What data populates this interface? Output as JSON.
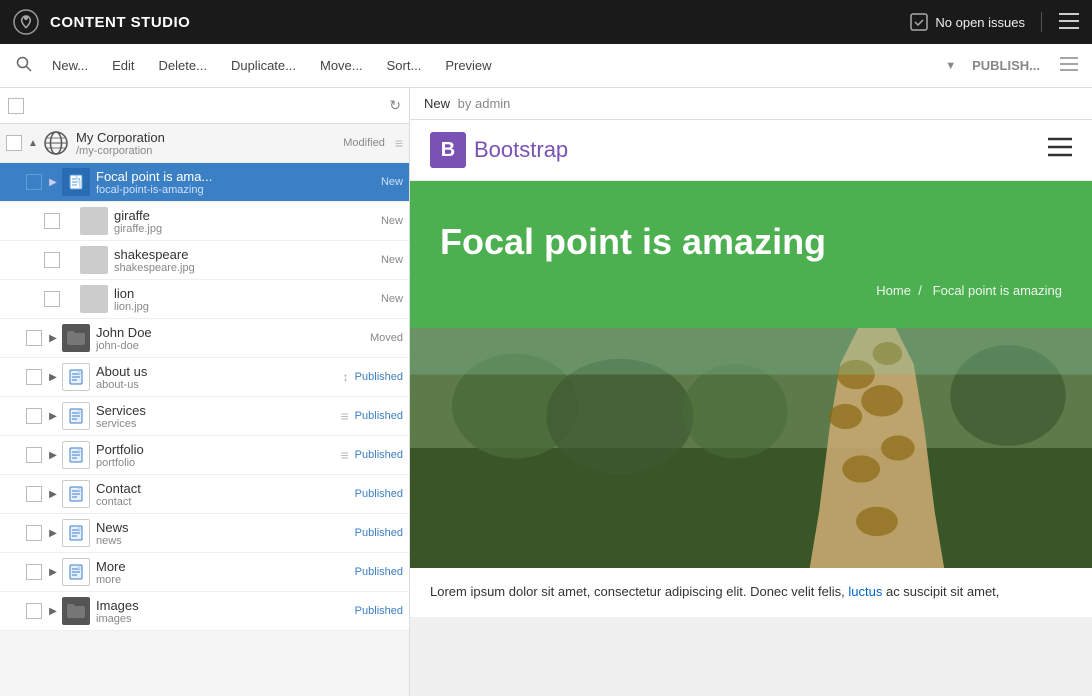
{
  "app": {
    "title": "CONTENT STUDIO",
    "issues": "No open issues"
  },
  "toolbar": {
    "search_label": "",
    "new_label": "New...",
    "edit_label": "Edit",
    "delete_label": "Delete...",
    "duplicate_label": "Duplicate...",
    "move_label": "Move...",
    "sort_label": "Sort...",
    "preview_label": "Preview",
    "publish_label": "PUBLISH..."
  },
  "tree": {
    "header_checkbox": false,
    "refresh_tooltip": "Refresh"
  },
  "tree_items": [
    {
      "id": "my-corporation",
      "name": "My Corporation",
      "path": "/my-corporation",
      "status": "Modified",
      "status_type": "modified",
      "indent": 0,
      "has_expand": true,
      "expanded": true,
      "icon_type": "globe",
      "has_checkbox": true,
      "has_menu": true,
      "checked": false
    },
    {
      "id": "focal-point",
      "name": "Focal point is ama...",
      "path": "focal-point-is-amazing",
      "status": "New",
      "status_type": "new",
      "indent": 1,
      "has_expand": true,
      "expanded": false,
      "icon_type": "page",
      "has_checkbox": true,
      "has_menu": false,
      "checked": false,
      "selected": true
    },
    {
      "id": "giraffe",
      "name": "giraffe",
      "path": "giraffe.jpg",
      "status": "New",
      "status_type": "new",
      "indent": 2,
      "has_expand": false,
      "icon_type": "image-giraffe",
      "has_checkbox": true,
      "has_menu": false,
      "checked": false
    },
    {
      "id": "shakespeare",
      "name": "shakespeare",
      "path": "shakespeare.jpg",
      "status": "New",
      "status_type": "new",
      "indent": 2,
      "has_expand": false,
      "icon_type": "image-shakespeare",
      "has_checkbox": true,
      "has_menu": false,
      "checked": false
    },
    {
      "id": "lion",
      "name": "lion",
      "path": "lion.jpg",
      "status": "New",
      "status_type": "new",
      "indent": 2,
      "has_expand": false,
      "icon_type": "image-lion",
      "has_checkbox": true,
      "has_menu": false,
      "checked": false
    },
    {
      "id": "john-doe",
      "name": "John Doe",
      "path": "john-doe",
      "status": "Moved",
      "status_type": "moved",
      "indent": 1,
      "has_expand": true,
      "expanded": false,
      "icon_type": "folder",
      "has_checkbox": true,
      "has_menu": false,
      "checked": false
    },
    {
      "id": "about-us",
      "name": "About us",
      "path": "about-us",
      "status": "Published",
      "status_type": "published",
      "indent": 1,
      "has_expand": true,
      "expanded": false,
      "icon_type": "page",
      "has_checkbox": true,
      "has_menu": false,
      "has_sort": true,
      "checked": false
    },
    {
      "id": "services",
      "name": "Services",
      "path": "services",
      "status": "Published",
      "status_type": "published",
      "indent": 1,
      "has_expand": true,
      "expanded": false,
      "icon_type": "page",
      "has_checkbox": true,
      "has_menu": true,
      "checked": false
    },
    {
      "id": "portfolio",
      "name": "Portfolio",
      "path": "portfolio",
      "status": "Published",
      "status_type": "published",
      "indent": 1,
      "has_expand": true,
      "expanded": false,
      "icon_type": "page",
      "has_checkbox": true,
      "has_menu": true,
      "checked": false
    },
    {
      "id": "contact",
      "name": "Contact",
      "path": "contact",
      "status": "Published",
      "status_type": "published",
      "indent": 1,
      "has_expand": true,
      "expanded": false,
      "icon_type": "page",
      "has_checkbox": true,
      "has_menu": false,
      "checked": false
    },
    {
      "id": "news",
      "name": "News",
      "path": "news",
      "status": "Published",
      "status_type": "published",
      "indent": 1,
      "has_expand": true,
      "expanded": false,
      "icon_type": "page",
      "has_checkbox": true,
      "has_menu": false,
      "checked": false
    },
    {
      "id": "more",
      "name": "More",
      "path": "more",
      "status": "Published",
      "status_type": "published",
      "indent": 1,
      "has_expand": true,
      "expanded": false,
      "icon_type": "page",
      "has_checkbox": true,
      "has_menu": false,
      "checked": false
    },
    {
      "id": "images",
      "name": "Images",
      "path": "images",
      "status": "Published",
      "status_type": "published",
      "indent": 1,
      "has_expand": true,
      "expanded": false,
      "icon_type": "folder",
      "has_checkbox": true,
      "has_menu": false,
      "checked": false
    }
  ],
  "preview": {
    "new_label": "New",
    "by_label": "by admin",
    "bootstrap_logo_b": "B",
    "bootstrap_logo_text": "Bootstrap",
    "hero_title": "Focal point is amazing",
    "hero_breadcrumb_home": "Home",
    "hero_breadcrumb_sep": "/",
    "hero_breadcrumb_current": "Focal point is amazing",
    "body_text_start": "Lorem ipsum dolor sit amet, consectetur adipiscing elit. Donec velit felis,",
    "body_text_link": "luctus",
    "body_text_end": "ac suscipit sit amet,"
  }
}
